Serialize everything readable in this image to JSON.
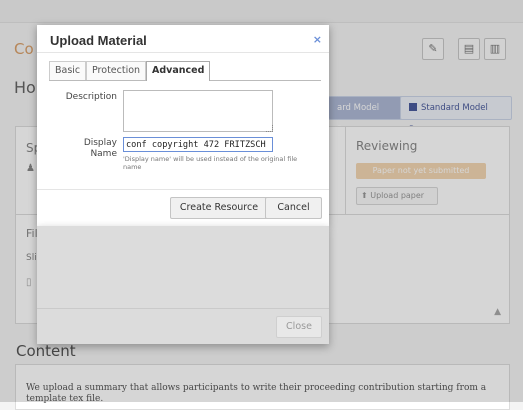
{
  "background": {
    "title_fragment": "Co",
    "heading_fragment": "Ho",
    "toolbar_icons": [
      "pencil-icon",
      "pdf-icon",
      "export-icon"
    ],
    "tags": [
      "ard Model Par...",
      "Standard Model Par..."
    ],
    "speakers_fragment": "Sp",
    "reviewing": {
      "title": "Reviewing",
      "status_button": "Paper not yet submitted",
      "upload_button": "Upload paper"
    },
    "files": {
      "label_fragment": "Fil",
      "slides_fragment": "Sli"
    },
    "content": {
      "heading": "Content",
      "text": "We upload a summary that allows participants to write their proceeding contribution starting from a template tex file."
    }
  },
  "modal": {
    "title": "Upload Material",
    "close_symbol": "×",
    "tabs": [
      {
        "label": "Basic",
        "active": false
      },
      {
        "label": "Protection",
        "active": false
      },
      {
        "label": "Advanced",
        "active": true
      }
    ],
    "description": {
      "label": "Description",
      "value": ""
    },
    "display_name": {
      "label": "Display Name",
      "value": "conf copyright 472 FRITZSCH",
      "hint": "'Display name' will be used instead of the original file name"
    },
    "buttons": {
      "create": "Create Resource",
      "cancel": "Cancel",
      "close": "Close"
    }
  },
  "colors": {
    "accent_blue": "#6a8fd8",
    "tag_blue": "#4a5b9c",
    "orange_fragment": "#d9a06a"
  }
}
